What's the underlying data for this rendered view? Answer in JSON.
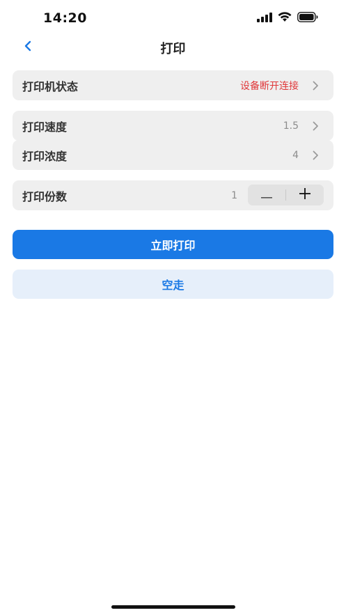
{
  "status_bar": {
    "time": "14:20",
    "icons": [
      "cellular-signal-icon",
      "wifi-icon",
      "battery-icon"
    ]
  },
  "nav": {
    "title": "打印",
    "back_icon": "chevron-left-icon"
  },
  "settings": {
    "printer_status": {
      "label": "打印机状态",
      "value": "设备断开连接"
    },
    "print_speed": {
      "label": "打印速度",
      "value": "1.5"
    },
    "print_density": {
      "label": "打印浓度",
      "value": "4"
    },
    "copies": {
      "label": "打印份数",
      "value": "1"
    }
  },
  "actions": {
    "print_now": "立即打印",
    "blank_feed": "空走"
  },
  "colors": {
    "accent": "#1a79e5",
    "error": "#e0383a",
    "row_bg": "#efefef",
    "secondary_bg": "#e6effa"
  }
}
